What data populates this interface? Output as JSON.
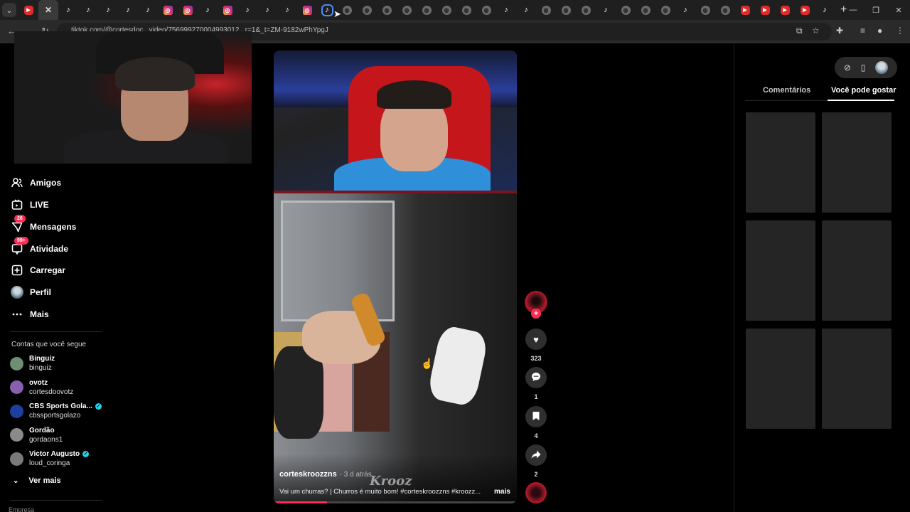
{
  "browser": {
    "tab_dropdown_icon": "chevron-down-icon",
    "tabs": [
      {
        "type": "yt",
        "glyph": "▶"
      },
      {
        "type": "x",
        "glyph": "✕",
        "active": true
      },
      {
        "type": "tt",
        "glyph": "♪"
      },
      {
        "type": "tt",
        "glyph": "♪"
      },
      {
        "type": "tt",
        "glyph": "♪"
      },
      {
        "type": "tt",
        "glyph": "♪"
      },
      {
        "type": "tt",
        "glyph": "♪"
      },
      {
        "type": "ig",
        "glyph": "◎"
      },
      {
        "type": "ig",
        "glyph": "◎"
      },
      {
        "type": "tt",
        "glyph": "♪"
      },
      {
        "type": "ig",
        "glyph": "◎"
      },
      {
        "type": "tt",
        "glyph": "♪"
      },
      {
        "type": "tt",
        "glyph": "♪"
      },
      {
        "type": "tt",
        "glyph": "♪"
      },
      {
        "type": "ig",
        "glyph": "◎"
      },
      {
        "type": "tt",
        "glyph": "♪",
        "current": true
      },
      {
        "type": "gl",
        "glyph": "◍"
      },
      {
        "type": "gl",
        "glyph": "◍"
      },
      {
        "type": "gl",
        "glyph": "◍"
      },
      {
        "type": "gl",
        "glyph": "◍"
      },
      {
        "type": "gl",
        "glyph": "◍"
      },
      {
        "type": "gl",
        "glyph": "◍"
      },
      {
        "type": "gl",
        "glyph": "◍"
      },
      {
        "type": "gl",
        "glyph": "◍"
      },
      {
        "type": "tt",
        "glyph": "♪"
      },
      {
        "type": "tt",
        "glyph": "♪"
      },
      {
        "type": "gl",
        "glyph": "◍"
      },
      {
        "type": "gl",
        "glyph": "◍"
      },
      {
        "type": "gl",
        "glyph": "◍"
      },
      {
        "type": "tt",
        "glyph": "♪"
      },
      {
        "type": "gl",
        "glyph": "◍"
      },
      {
        "type": "gl",
        "glyph": "◍"
      },
      {
        "type": "gl",
        "glyph": "◍"
      },
      {
        "type": "tt",
        "glyph": "♪"
      },
      {
        "type": "gl",
        "glyph": "◍"
      },
      {
        "type": "gl",
        "glyph": "◍"
      },
      {
        "type": "yt",
        "glyph": "▶"
      },
      {
        "type": "yt",
        "glyph": "▶"
      },
      {
        "type": "yt",
        "glyph": "▶"
      },
      {
        "type": "yt",
        "glyph": "▶"
      },
      {
        "type": "tt",
        "glyph": "♪"
      }
    ],
    "new_tab_glyph": "+",
    "window_controls": [
      "—",
      "❐",
      "✕"
    ],
    "url": "tiktok.com/@cortesdoc...video/756999270004993012...r=1&_t=ZM-9182wPhYpgJ",
    "toolbar_icons": [
      "install-icon",
      "star-icon",
      "extensions-icon",
      "media-icon",
      "profile-icon",
      "menu-icon"
    ]
  },
  "sidebar": {
    "items": [
      {
        "name": "amigos",
        "label": "Amigos",
        "icon": "👥"
      },
      {
        "name": "live",
        "label": "LIVE",
        "icon": "▣"
      },
      {
        "name": "mensagens",
        "label": "Mensagens",
        "icon": "✈",
        "badge": "26"
      },
      {
        "name": "atividade",
        "label": "Atividade",
        "icon": "☐",
        "badge": "99+"
      },
      {
        "name": "carregar",
        "label": "Carregar",
        "icon": "⊞"
      },
      {
        "name": "perfil",
        "label": "Perfil",
        "icon": "●"
      },
      {
        "name": "mais",
        "label": "Mais",
        "icon": "···"
      }
    ],
    "following_title": "Contas que você segue",
    "accounts": [
      {
        "name": "Binguiz",
        "handle": "binguiz",
        "verified": false,
        "color": "#6d8f72"
      },
      {
        "name": "ovotz",
        "handle": "cortesdoovotz",
        "verified": false,
        "color": "#8b5fb0"
      },
      {
        "name": "CBS Sports Gola...",
        "handle": "cbssportsgolazo",
        "verified": true,
        "color": "#1c3fa0"
      },
      {
        "name": "Gordão",
        "handle": "gordaons1",
        "verified": false,
        "color": "#8a8a8a"
      },
      {
        "name": "Victor Augusto",
        "handle": "loud_coringa",
        "verified": true,
        "color": "#7a7a7a"
      }
    ],
    "see_more": "Ver mais",
    "company": "Empresa"
  },
  "video": {
    "username": "corteskroozzns",
    "date": "· 3 d atrás",
    "caption": "Vai um churras? | Churros é muito bom! #corteskroozzns #kroozz...",
    "more": "mais",
    "watermark": "Krooz",
    "progress": 0.22
  },
  "actions": {
    "likes": "323",
    "comments": "1",
    "saves": "4",
    "shares": "2"
  },
  "right_panel": {
    "tabs": [
      "Comentários",
      "Você pode gostar"
    ],
    "active_tab": "Você pode gostar",
    "thumbnail_count": 6
  }
}
